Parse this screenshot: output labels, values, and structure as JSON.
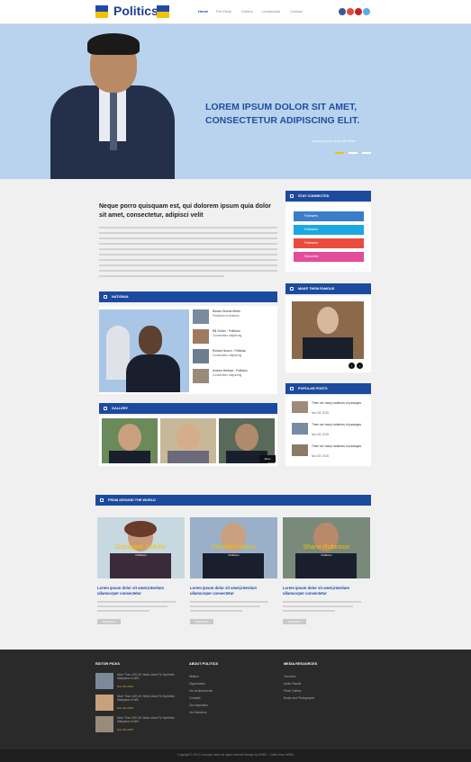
{
  "header": {
    "logo": "Politics",
    "nav": [
      {
        "label": "Home"
      },
      {
        "label": "Pre-Party"
      },
      {
        "label": "Gallery"
      },
      {
        "label": "Leadership"
      },
      {
        "label": "Contact"
      }
    ],
    "social": [
      "facebook",
      "google-plus",
      "pinterest",
      "twitter"
    ],
    "social_colors": [
      "#3b5998",
      "#dd4b39",
      "#cb2027",
      "#55acee"
    ]
  },
  "hero": {
    "headline_1": "LOREM IPSUM DOLOR SIT AMET,",
    "headline_2": "CONSECTETUR ADIPISCING ELIT.",
    "sub": "Lorem ipsum dolor sit amet"
  },
  "main": {
    "title": "Neque porro quisquam est, qui dolorem ipsum quia dolor sit amet, consectetur, adipisci velit"
  },
  "sections": {
    "national": "NATIONAL",
    "gallery": "GALLERY",
    "world": "FROM AROUND THE WORLD",
    "stay": "STAY CONNECTED",
    "famous": "MAKE THEM FAMOUS",
    "popular": "POPULAR POSTS"
  },
  "national_list": [
    {
      "title": "Barack Obama Meets",
      "sub": "President of America"
    },
    {
      "title": "Bill Clinton - Politician",
      "sub": "Consectetur adipiscing"
    },
    {
      "title": "Richard Nixson - Politician",
      "sub": "Consectetur adipiscing"
    },
    {
      "title": "Andrew Benlase - Politician",
      "sub": "Consectetur adipiscing"
    }
  ],
  "social_rows": [
    {
      "label": "Followers",
      "color": "#3b7dc9"
    },
    {
      "label": "Followers",
      "color": "#1ca8e0"
    },
    {
      "label": "Followers",
      "color": "#e94b3c"
    },
    {
      "label": "Subscribe",
      "color": "#e24c9a"
    }
  ],
  "popular": [
    {
      "title": "There are many variations of passages",
      "date": "Nov 28, 2015"
    },
    {
      "title": "There are many variations of passages",
      "date": "Nov 28, 2015"
    },
    {
      "title": "There are many variations of passages",
      "date": "Nov 28, 2015"
    }
  ],
  "gallery_more": "More",
  "world": [
    {
      "name": "Domegral Jinkolor",
      "role": "Politician",
      "title": "Lorem ipsum dolor sit amet,interdum ullamcorper consectetur",
      "btn": "Read More"
    },
    {
      "name": "Stephen Harper",
      "role": "Politician",
      "title": "Lorem ipsum dolor sit amet,interdum ullamcorper consectetur",
      "btn": "Read More"
    },
    {
      "name": "Shane Robinson",
      "role": "Politician",
      "title": "Lorem ipsum dolor sit amet,interdum ullamcorper consectetur",
      "btn": "Read More"
    }
  ],
  "footer": {
    "col1": "EDITOR PICKS",
    "col2": "ABOUT POLITICS",
    "col3": "MEDIA RESOURCES",
    "picks": [
      {
        "title": "More Than 100 UK Visits Linked To Synthetic Marijuana In Will.",
        "date": "Nov 28, 2015"
      },
      {
        "title": "More Than 100 UK Visits Linked To Synthetic Marijuana In Will.",
        "date": "Nov 28, 2015"
      },
      {
        "title": "More Than 100 UK Visits Linked To Synthetic Marijuana In Will.",
        "date": "Nov 28, 2015"
      }
    ],
    "about": [
      "Mission",
      "Organization",
      "Our Achievements",
      "Contacts",
      "Our Inspiration",
      "Our Members"
    ],
    "media": [
      "Overview",
      "Audio Visuals",
      "Photo Gallery",
      "Books and Photographs"
    ],
    "copyright": "Copyright © 2015 Company name All rights reserved Design by MOBX . Collect from MOBX"
  }
}
